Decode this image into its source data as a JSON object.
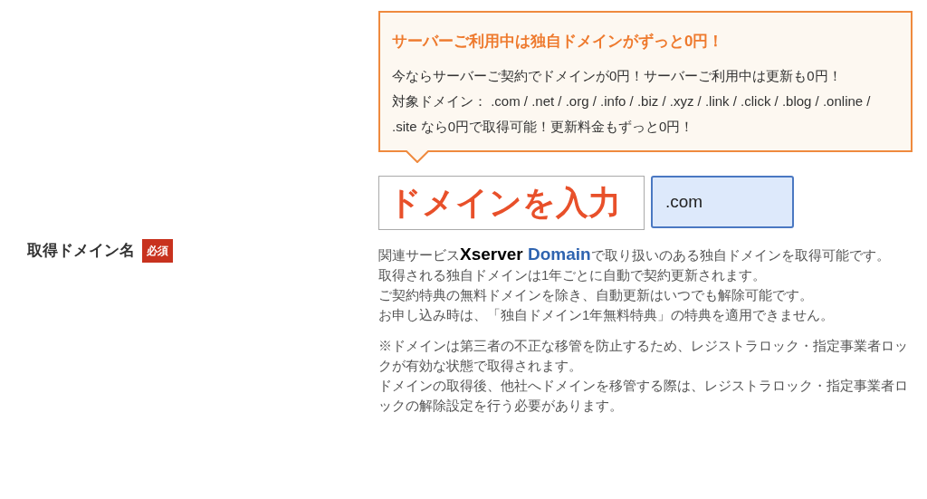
{
  "notice": {
    "title": "サーバーご利用中は独自ドメインがずっと0円！",
    "paragraphs": [
      "今ならサーバーご契約でドメインが0円！サーバーご利用中は更新も0円！",
      "対象ドメイン： .com / .net / .org / .info / .biz / .xyz / .link / .click / .blog / .online / .site なら0円で取得可能！更新料金もずっと0円！"
    ]
  },
  "field": {
    "label": "取得ドメイン名",
    "required_badge": "必須",
    "domain_placeholder": "ドメインを入力",
    "tld": ".com"
  },
  "notes": {
    "first": {
      "before": "関連サービス",
      "logo_dark": "Xserver",
      "logo_blue": "Domain",
      "after": "で取り扱いのある独自ドメインを取得可能です。"
    },
    "lines": [
      "取得される独自ドメインは1年ごとに自動で契約更新されます。",
      "ご契約特典の無料ドメインを除き、自動更新はいつでも解除可能です。",
      "お申し込み時は、「独自ドメイン1年無料特典」の特典を適用できません。"
    ],
    "warnings": [
      "※ドメインは第三者の不正な移管を防止するため、レジストラロック・指定事業者ロックが有効な状態で取得されます。",
      "ドメインの取得後、他社へドメインを移管する際は、レジストラロック・指定事業者ロックの解除設定を行う必要があります。"
    ]
  }
}
